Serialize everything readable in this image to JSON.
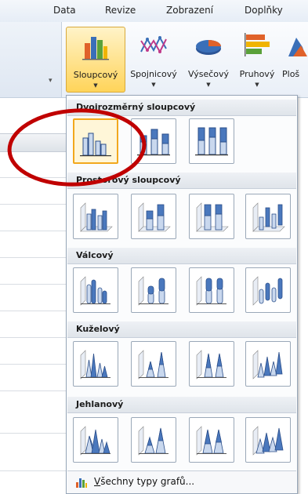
{
  "menu": {
    "tabs": [
      "Data",
      "Revize",
      "Zobrazení",
      "Doplňky"
    ]
  },
  "ribbon": {
    "buttons": [
      {
        "label": "Sloupcový",
        "icon": "column-chart-icon",
        "active": true
      },
      {
        "label": "Spojnicový",
        "icon": "line-chart-icon"
      },
      {
        "label": "Výsečový",
        "icon": "pie-chart-icon"
      },
      {
        "label": "Pruhový",
        "icon": "bar-chart-icon"
      },
      {
        "label": "Ploš",
        "icon": "area-chart-icon"
      }
    ]
  },
  "gallery": {
    "categories": [
      {
        "title": "Dvojrozměrný sloupcový",
        "count": 3
      },
      {
        "title": "Prostorový sloupcový",
        "count": 4
      },
      {
        "title": "Válcový",
        "count": 4
      },
      {
        "title": "Kuželový",
        "count": 4
      },
      {
        "title": "Jehlanový",
        "count": 4
      }
    ],
    "footer": {
      "label_prefix": "V",
      "label_rest": "šechny typy grafů..."
    }
  },
  "colors": {
    "active_button": "#ffd45a",
    "annotation": "#c00000",
    "chart_blue": "#4a78bd"
  }
}
